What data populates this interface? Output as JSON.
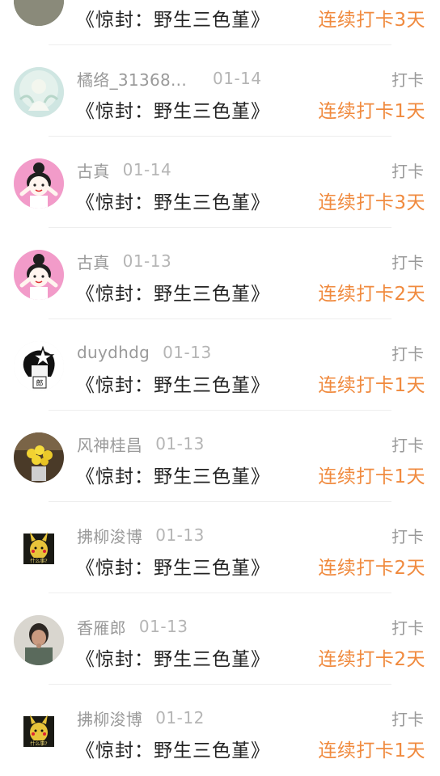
{
  "checkins": [
    {
      "avatar": "avatar-landscape",
      "name": "",
      "date": "",
      "tag": "",
      "title": "《惊封：野生三色堇》",
      "streak": "连续打卡3天"
    },
    {
      "avatar": "avatar-fairy",
      "name": "橘络_31368...",
      "date": "01-14",
      "tag": "打卡",
      "title": "《惊封：野生三色堇》",
      "streak": "连续打卡1天"
    },
    {
      "avatar": "avatar-pink-girl",
      "name": "古真",
      "date": "01-14",
      "tag": "打卡",
      "title": "《惊封：野生三色堇》",
      "streak": "连续打卡3天"
    },
    {
      "avatar": "avatar-pink-girl",
      "name": "古真",
      "date": "01-13",
      "tag": "打卡",
      "title": "《惊封：野生三色堇》",
      "streak": "连续打卡2天"
    },
    {
      "avatar": "avatar-sketch",
      "name": "duydhdg",
      "date": "01-13",
      "tag": "打卡",
      "title": "《惊封：野生三色堇》",
      "streak": "连续打卡1天"
    },
    {
      "avatar": "avatar-flowers",
      "name": "风神桂昌",
      "date": "01-13",
      "tag": "打卡",
      "title": "《惊封：野生三色堇》",
      "streak": "连续打卡1天"
    },
    {
      "avatar": "avatar-pikachu",
      "name": "拂柳浚博",
      "date": "01-13",
      "tag": "打卡",
      "title": "《惊封：野生三色堇》",
      "streak": "连续打卡2天"
    },
    {
      "avatar": "avatar-photo",
      "name": "香雁郎",
      "date": "01-13",
      "tag": "打卡",
      "title": "《惊封：野生三色堇》",
      "streak": "连续打卡2天"
    },
    {
      "avatar": "avatar-pikachu",
      "name": "拂柳浚博",
      "date": "01-12",
      "tag": "打卡",
      "title": "《惊封：野生三色堇》",
      "streak": "连续打卡1天"
    }
  ]
}
